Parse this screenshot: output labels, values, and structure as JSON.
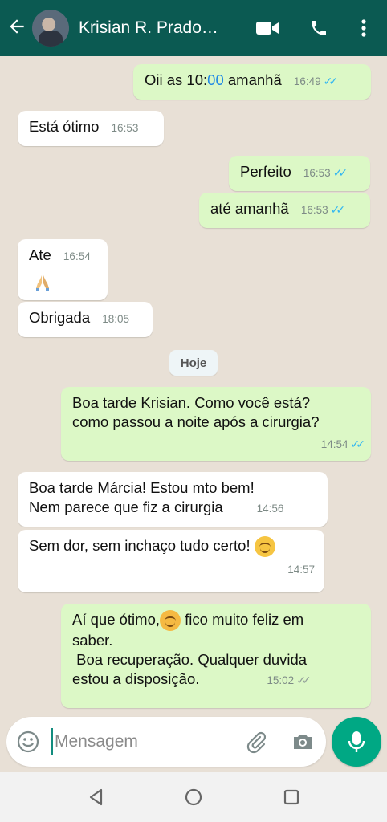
{
  "header": {
    "back_icon": "arrow-left-icon",
    "contact_name": "Krisian R. Prado…",
    "video_icon": "video-call-icon",
    "call_icon": "phone-icon",
    "more_icon": "more-vertical-icon"
  },
  "messages": [
    {
      "dir": "out",
      "text_a": "Oii as 10:",
      "text_b": "00",
      "text_c": " amanhã",
      "time": "16:49",
      "status": "read"
    },
    {
      "dir": "in",
      "text": "Está ótimo",
      "time": "16:53"
    },
    {
      "dir": "out",
      "text": "Perfeito",
      "time": "16:53",
      "status": "read"
    },
    {
      "dir": "out",
      "text": "até amanhã",
      "time": "16:53",
      "status": "read"
    },
    {
      "dir": "in",
      "text": "Ate",
      "time": "16:54"
    },
    {
      "dir": "in",
      "text": "Obrigada",
      "time": "18:05"
    },
    {
      "dir": "out",
      "text_line1": "Boa tarde Krisian. Como você está?",
      "text_line2": "como passou a noite após a cirurgia?",
      "time": "14:54",
      "status": "read"
    },
    {
      "dir": "in",
      "text_line1": "Boa tarde Márcia! Estou mto bem!",
      "text_line2": "Nem parece que fiz a cirurgia",
      "time": "14:56"
    },
    {
      "dir": "in",
      "text": "Sem dor, sem inchaço tudo certo!",
      "time": "14:57"
    },
    {
      "dir": "out",
      "text_line1a": "Aí que ótimo,",
      "text_line1b": " fico muito feliz em",
      "text_line2": "saber.",
      "text_line3": " Boa recuperação. Qualquer duvida",
      "text_line4": "estou a disposição.",
      "time": "15:02",
      "status": "delivered"
    }
  ],
  "day_separator": "Hoje",
  "composer": {
    "placeholder": "Mensagem",
    "emoji_icon": "emoji-icon",
    "attach_icon": "paperclip-icon",
    "camera_icon": "camera-icon",
    "mic_icon": "microphone-icon"
  },
  "colors": {
    "header": "#0b5a52",
    "outgoing_bubble": "#dcf8c6",
    "incoming_bubble": "#ffffff",
    "read_ticks": "#34b7f1",
    "mic_button": "#00a884"
  }
}
